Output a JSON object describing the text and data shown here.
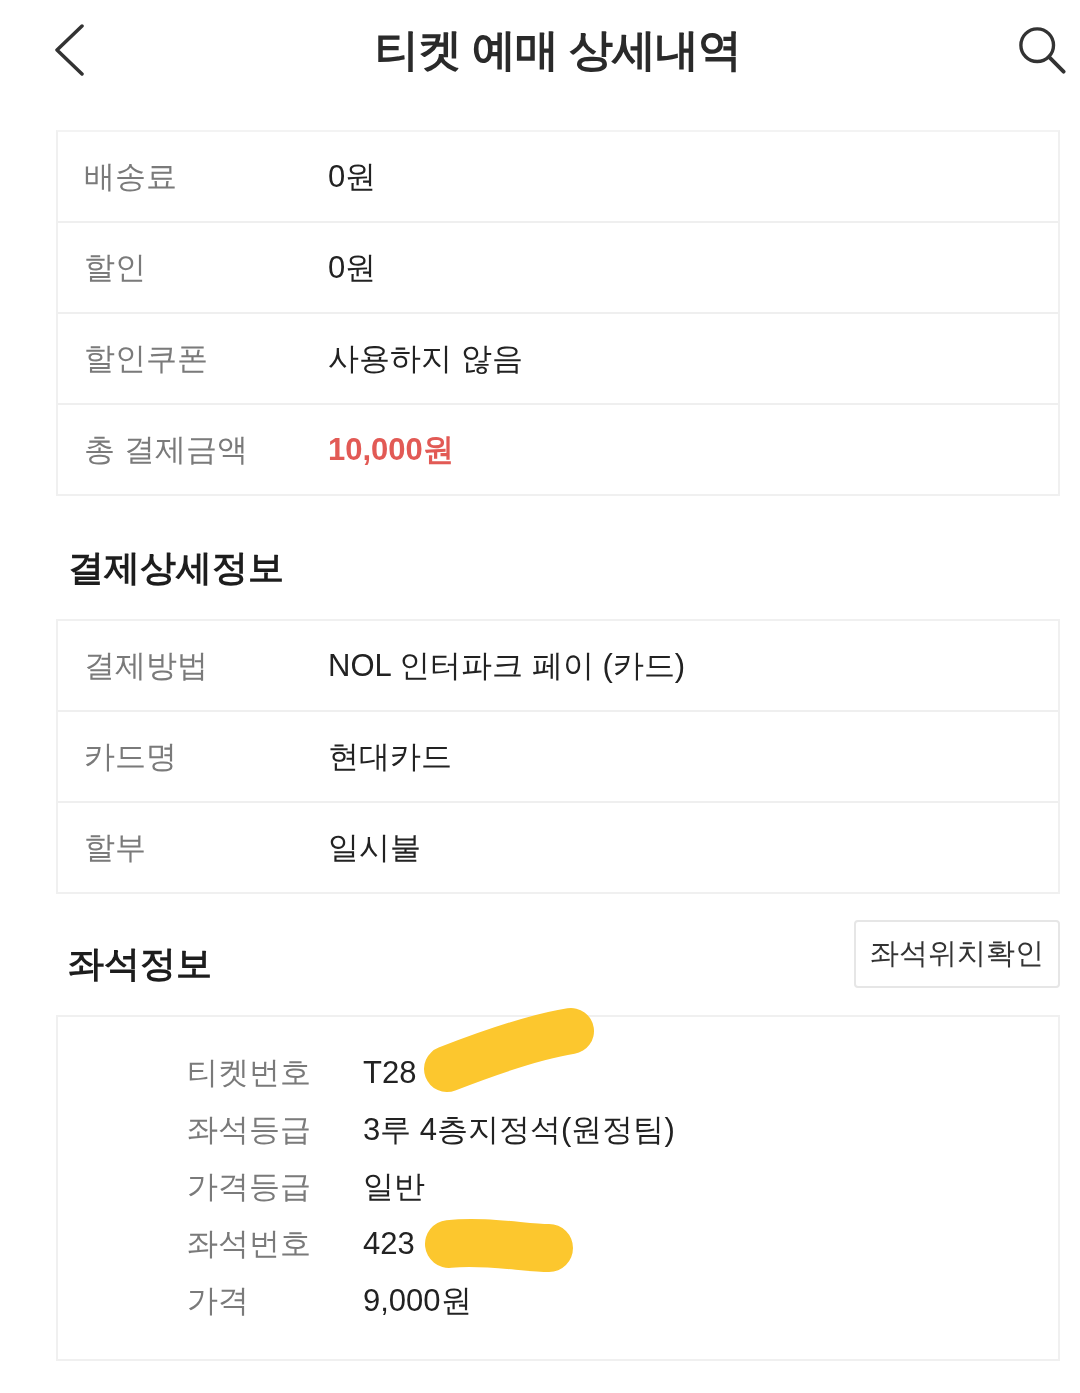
{
  "header": {
    "title": "티켓 예매 상세내역"
  },
  "price_summary": {
    "rows": [
      {
        "label": "배송료",
        "value": "0원",
        "highlighted": false
      },
      {
        "label": "할인",
        "value": "0원",
        "highlighted": false
      },
      {
        "label": "할인쿠폰",
        "value": "사용하지 않음",
        "highlighted": false
      },
      {
        "label": "총 결제금액",
        "value": "10,000원",
        "highlighted": true
      }
    ]
  },
  "payment_details": {
    "title": "결제상세정보",
    "rows": [
      {
        "label": "결제방법",
        "value": "NOL 인터파크 페이 (카드)"
      },
      {
        "label": "카드명",
        "value": "현대카드"
      },
      {
        "label": "할부",
        "value": "일시불"
      }
    ]
  },
  "seat_info": {
    "title": "좌석정보",
    "button": "좌석위치확인",
    "rows": [
      {
        "label": "티켓번호",
        "value": "T28",
        "redacted": true
      },
      {
        "label": "좌석등급",
        "value": "3루 4층지정석(원정팀)",
        "redacted": false
      },
      {
        "label": "가격등급",
        "value": "일반",
        "redacted": false
      },
      {
        "label": "좌석번호",
        "value": "423",
        "redacted": true
      },
      {
        "label": "가격",
        "value": "9,000원",
        "redacted": false
      }
    ]
  }
}
